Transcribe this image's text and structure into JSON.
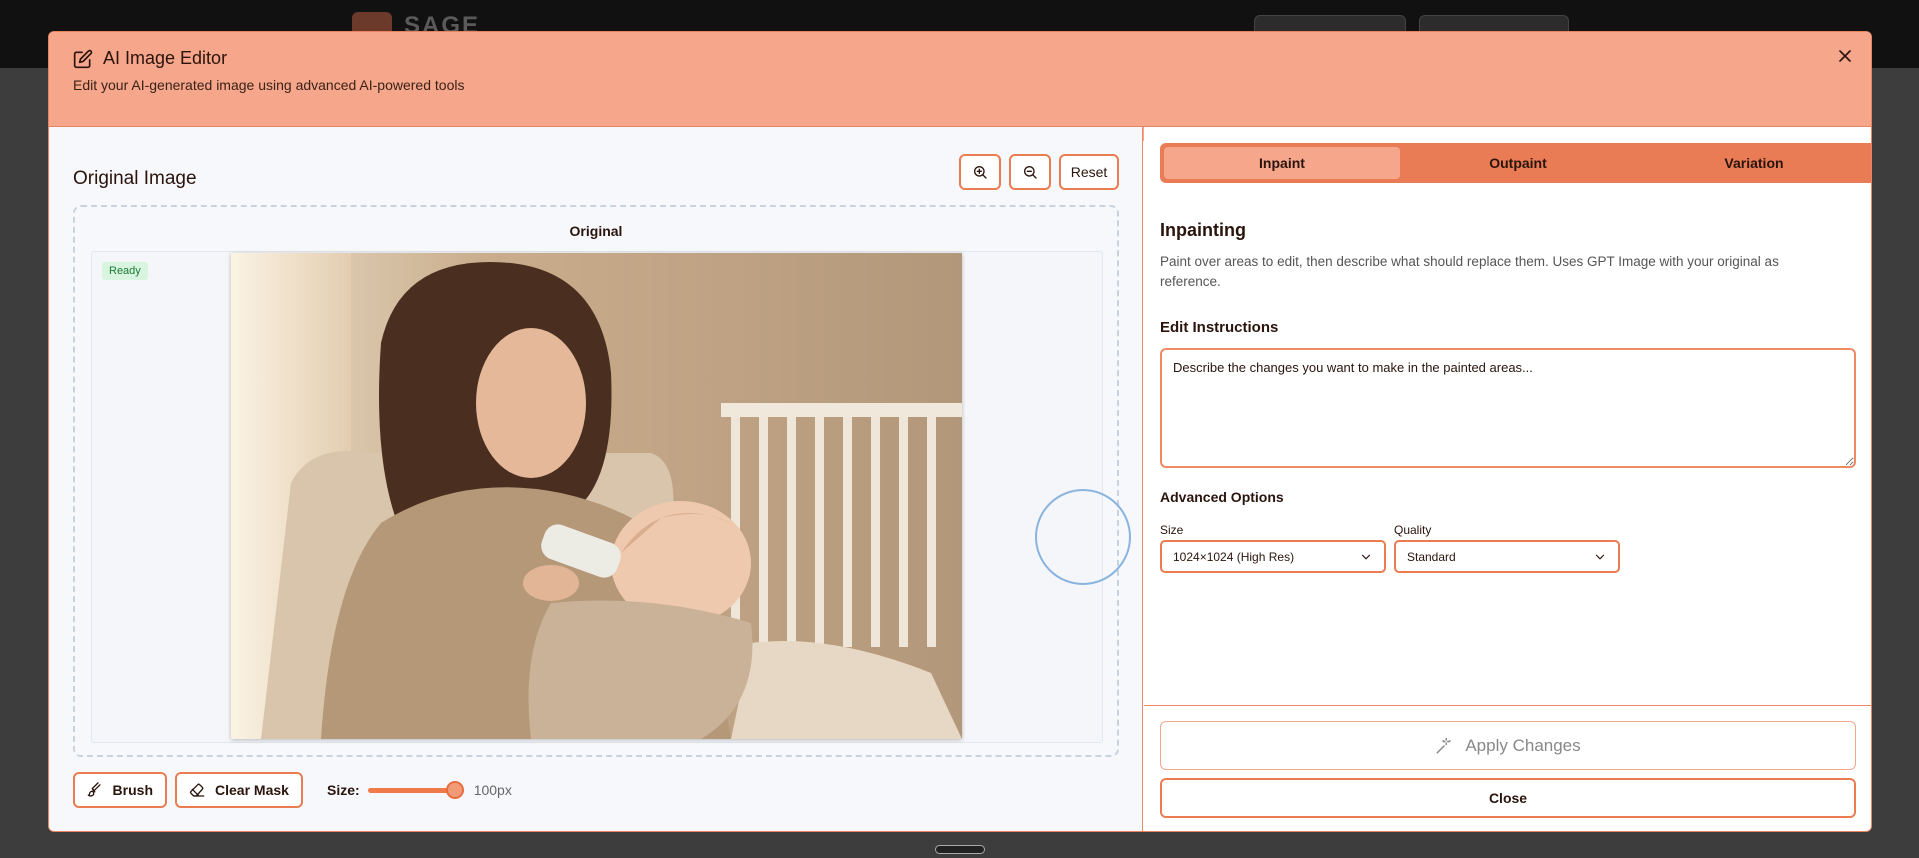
{
  "background": {
    "logo_text": "SAGE"
  },
  "modal": {
    "title": "AI Image Editor",
    "subtitle": "Edit your AI-generated image using advanced AI-powered tools",
    "icons": {
      "title": "edit-icon",
      "close": "close-icon"
    }
  },
  "left_panel": {
    "title": "Original Image",
    "reset_label": "Reset",
    "canvas_label": "Original",
    "status_badge": "Ready",
    "brush_label": "Brush",
    "clear_mask_label": "Clear Mask",
    "size_label": "Size:",
    "size_value": "100px",
    "brush_size_fraction": 1.0
  },
  "right_panel": {
    "tabs": [
      {
        "label": "Inpaint",
        "active": true
      },
      {
        "label": "Outpaint",
        "active": false
      },
      {
        "label": "Variation",
        "active": false
      }
    ],
    "section_title": "Inpainting",
    "description": "Paint over areas to edit, then describe what should replace them. Uses GPT Image with your original as reference.",
    "instructions_label": "Edit Instructions",
    "instructions_placeholder": "Describe the changes you want to make in the painted areas...",
    "advanced_label": "Advanced Options",
    "size_field_label": "Size",
    "size_value": "1024×1024 (High Res)",
    "quality_field_label": "Quality",
    "quality_value": "Standard",
    "apply_label": "Apply Changes",
    "close_label": "Close"
  },
  "colors": {
    "accent": "#ea7c52",
    "header": "#f5a68b",
    "tab_bar": "#e97c55",
    "ready_bg": "#d9f5df",
    "ready_text": "#1c7a37"
  }
}
